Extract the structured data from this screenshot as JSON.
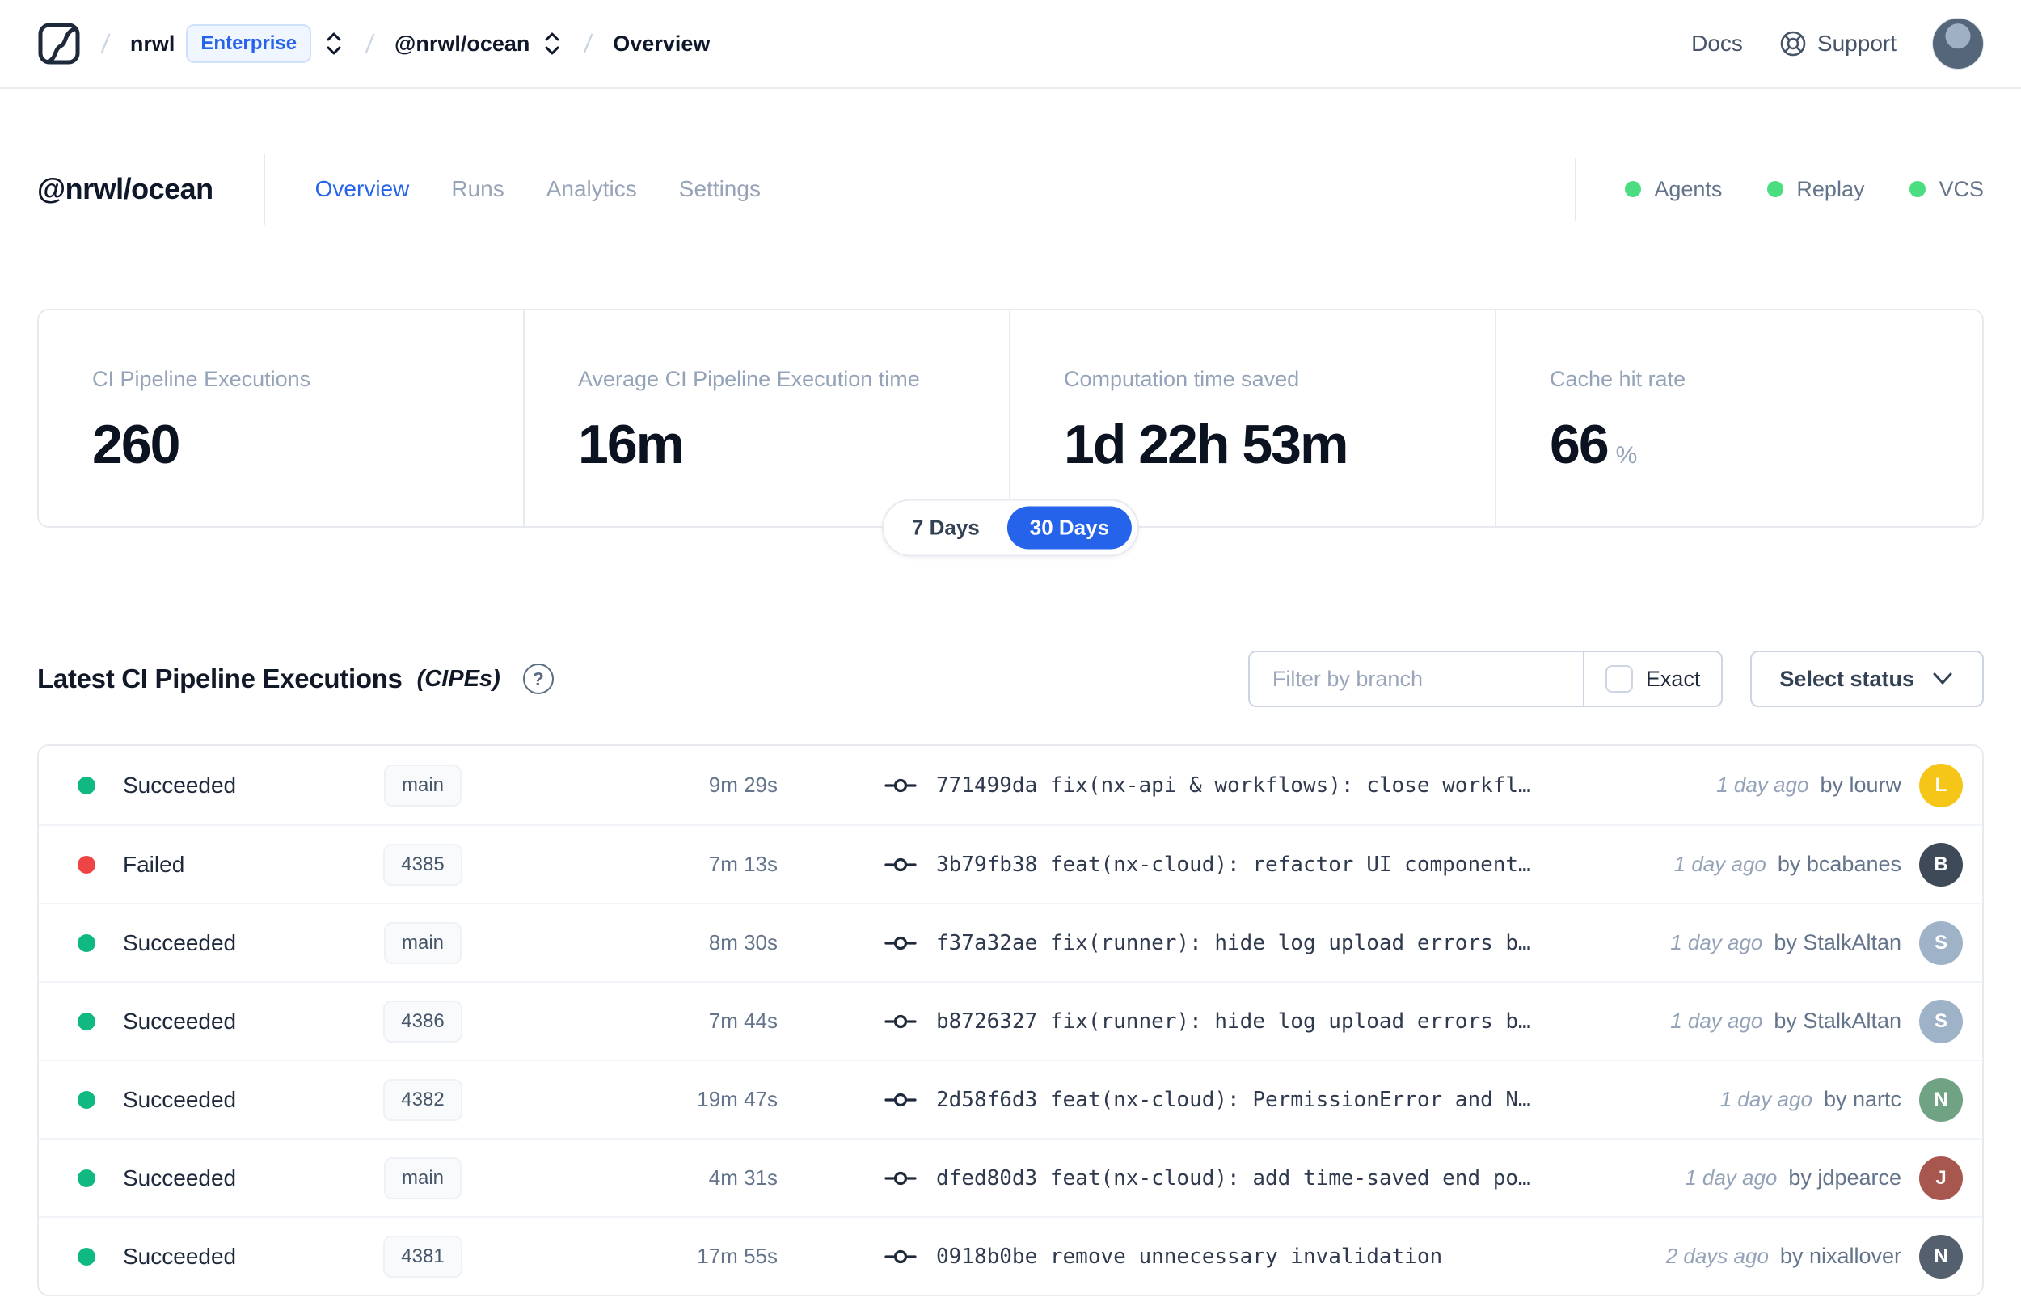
{
  "colors": {
    "green": "#10b981",
    "red": "#ef4444",
    "indicator_green": "#4ade80",
    "accent_blue": "#2563eb"
  },
  "navbar": {
    "breadcrumb": {
      "org": "nrwl",
      "org_badge": "Enterprise",
      "workspace": "@nrwl/ocean",
      "page": "Overview"
    },
    "docs_label": "Docs",
    "support_label": "Support"
  },
  "workspace_header": {
    "title": "@nrwl/ocean",
    "tabs": [
      {
        "label": "Overview",
        "active": true
      },
      {
        "label": "Runs",
        "active": false
      },
      {
        "label": "Analytics",
        "active": false
      },
      {
        "label": "Settings",
        "active": false
      }
    ],
    "status_indicators": [
      {
        "label": "Agents"
      },
      {
        "label": "Replay"
      },
      {
        "label": "VCS"
      }
    ]
  },
  "stats": {
    "cards": [
      {
        "label": "CI Pipeline Executions",
        "value": "260",
        "unit": ""
      },
      {
        "label": "Average CI Pipeline Execution time",
        "value": "16m",
        "unit": ""
      },
      {
        "label": "Computation time saved",
        "value": "1d 22h 53m",
        "unit": ""
      },
      {
        "label": "Cache hit rate",
        "value": "66",
        "unit": "%"
      }
    ]
  },
  "range_toggle": {
    "options": [
      {
        "label": "7 Days",
        "selected": false
      },
      {
        "label": "30 Days",
        "selected": true
      }
    ]
  },
  "cipes": {
    "title": "Latest CI Pipeline Executions",
    "subtitle": "(CIPEs)",
    "filter_placeholder": "Filter by branch",
    "exact_label": "Exact",
    "status_dropdown_label": "Select status",
    "rows": [
      {
        "status": "Succeeded",
        "status_color": "green",
        "branch": "main",
        "duration": "9m 29s",
        "commit": "771499da fix(nx-api & workflows): close workfl…",
        "time_ago": "1 day ago",
        "author": "by lourw",
        "avatar_initial": "L",
        "avatar_color": "#f5c518"
      },
      {
        "status": "Failed",
        "status_color": "red",
        "branch": "4385",
        "duration": "7m 13s",
        "commit": "3b79fb38 feat(nx-cloud): refactor UI component…",
        "time_ago": "1 day ago",
        "author": "by bcabanes",
        "avatar_initial": "B",
        "avatar_color": "#3f4a58"
      },
      {
        "status": "Succeeded",
        "status_color": "green",
        "branch": "main",
        "duration": "8m 30s",
        "commit": "f37a32ae fix(runner): hide log upload errors b…",
        "time_ago": "1 day ago",
        "author": "by StalkAltan",
        "avatar_initial": "S",
        "avatar_color": "#9fb3c8"
      },
      {
        "status": "Succeeded",
        "status_color": "green",
        "branch": "4386",
        "duration": "7m 44s",
        "commit": "b8726327 fix(runner): hide log upload errors b…",
        "time_ago": "1 day ago",
        "author": "by StalkAltan",
        "avatar_initial": "S",
        "avatar_color": "#9fb3c8"
      },
      {
        "status": "Succeeded",
        "status_color": "green",
        "branch": "4382",
        "duration": "19m 47s",
        "commit": "2d58f6d3 feat(nx-cloud): PermissionError and N…",
        "time_ago": "1 day ago",
        "author": "by nartc",
        "avatar_initial": "N",
        "avatar_color": "#6fa384"
      },
      {
        "status": "Succeeded",
        "status_color": "green",
        "branch": "main",
        "duration": "4m 31s",
        "commit": "dfed80d3 feat(nx-cloud): add time-saved end po…",
        "time_ago": "1 day ago",
        "author": "by jdpearce",
        "avatar_initial": "J",
        "avatar_color": "#a8574f"
      },
      {
        "status": "Succeeded",
        "status_color": "green",
        "branch": "4381",
        "duration": "17m 55s",
        "commit": "0918b0be remove unnecessary invalidation",
        "time_ago": "2 days ago",
        "author": "by nixallover",
        "avatar_initial": "N",
        "avatar_color": "#55606e"
      }
    ]
  }
}
